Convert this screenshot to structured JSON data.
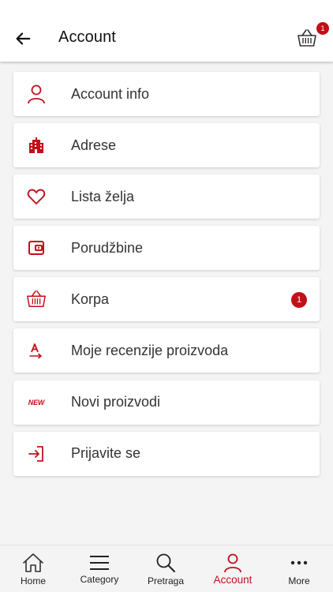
{
  "colors": {
    "accent": "#c0101a",
    "background": "#f4f4f4",
    "card": "#ffffff",
    "text": "#333333"
  },
  "header": {
    "title": "Account",
    "back_icon": "arrow-left-icon",
    "cart_icon": "basket-icon",
    "cart_count": "1"
  },
  "menu": {
    "items": [
      {
        "label": "Account info",
        "icon": "user-icon"
      },
      {
        "label": "Adrese",
        "icon": "buildings-icon"
      },
      {
        "label": "Lista želja",
        "icon": "heart-icon"
      },
      {
        "label": "Porudžbine",
        "icon": "wallet-icon"
      },
      {
        "label": "Korpa",
        "icon": "basket-icon",
        "badge": "1"
      },
      {
        "label": "Moje recenzije proizvoda",
        "icon": "review-icon"
      },
      {
        "label": "Novi proizvodi",
        "icon": "new-icon",
        "icon_text": "NEW"
      },
      {
        "label": "Prijavite se",
        "icon": "sign-in-icon"
      }
    ]
  },
  "tabbar": {
    "active": "Account",
    "tabs": [
      {
        "label": "Home",
        "icon": "home-icon"
      },
      {
        "label": "Category",
        "icon": "menu-icon"
      },
      {
        "label": "Pretraga",
        "icon": "search-icon"
      },
      {
        "label": "Account",
        "icon": "user-icon"
      },
      {
        "label": "More",
        "icon": "more-icon"
      }
    ]
  }
}
